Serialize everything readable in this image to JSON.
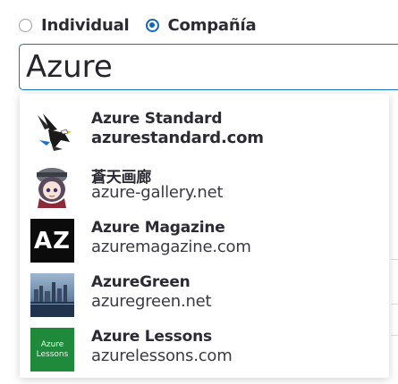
{
  "radio": {
    "individual_label": "Individual",
    "company_label": "Compañía",
    "selected": "company"
  },
  "search": {
    "value": "Azure"
  },
  "suggestions": [
    {
      "name": "Azure Standard",
      "domain": "azurestandard.com",
      "logo": "eagle-logo-icon"
    },
    {
      "name": "蒼天画廊",
      "domain": "azure-gallery.net",
      "logo": "anime-character-logo-icon"
    },
    {
      "name": "Azure Magazine",
      "domain": "azuremagazine.com",
      "logo": "az-logo-icon",
      "logo_text": "AZ"
    },
    {
      "name": "AzureGreen",
      "domain": "azuregreen.net",
      "logo": "city-skyline-logo-icon"
    },
    {
      "name": "Azure Lessons",
      "domain": "azurelessons.com",
      "logo": "azure-lessons-logo-icon",
      "logo_lines": [
        "Azure",
        "Lessons"
      ]
    }
  ],
  "colors": {
    "accent": "#1565c0",
    "input_border": "#1a73c8",
    "text": "#2b2b36"
  }
}
